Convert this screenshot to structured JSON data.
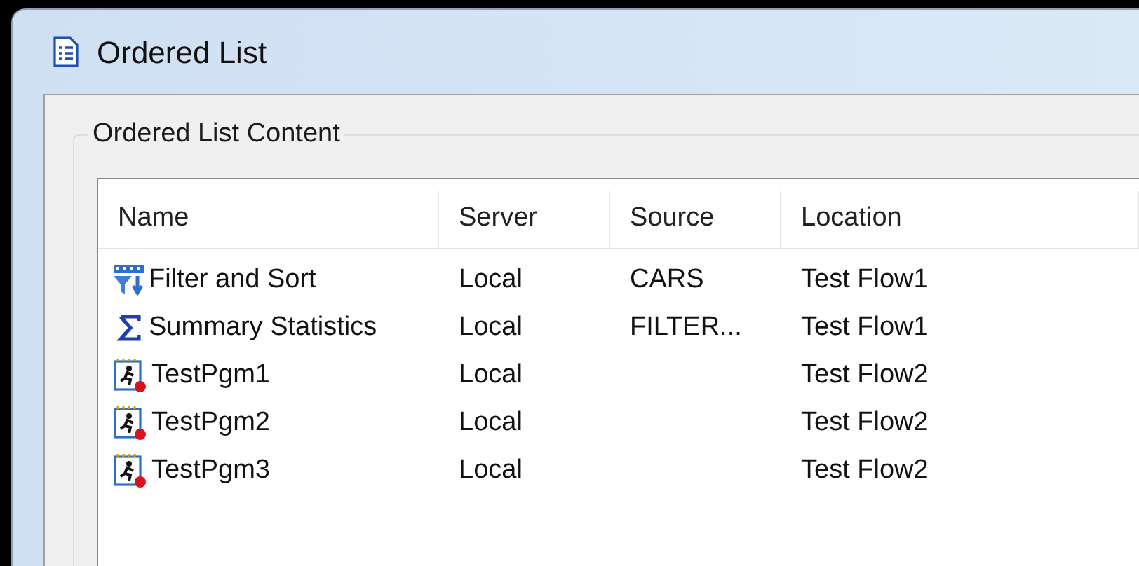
{
  "window": {
    "title": "Ordered List"
  },
  "group": {
    "title": "Ordered List Content"
  },
  "table": {
    "columns": [
      "Name",
      "Server",
      "Source",
      "Location"
    ],
    "rows": [
      {
        "kind": "filter",
        "name": "Filter and Sort",
        "server": "Local",
        "source": "CARS",
        "location": "Test Flow1"
      },
      {
        "kind": "statistics",
        "name": "Summary Statistics",
        "server": "Local",
        "source": "FILTER...",
        "location": "Test Flow1"
      },
      {
        "kind": "program",
        "name": "TestPgm1",
        "server": "Local",
        "location": "Test Flow2"
      },
      {
        "kind": "program",
        "name": "TestPgm2",
        "server": "Local",
        "location": "Test Flow2"
      },
      {
        "kind": "program",
        "name": "TestPgm3",
        "server": "Local",
        "location": "Test Flow2"
      }
    ]
  }
}
